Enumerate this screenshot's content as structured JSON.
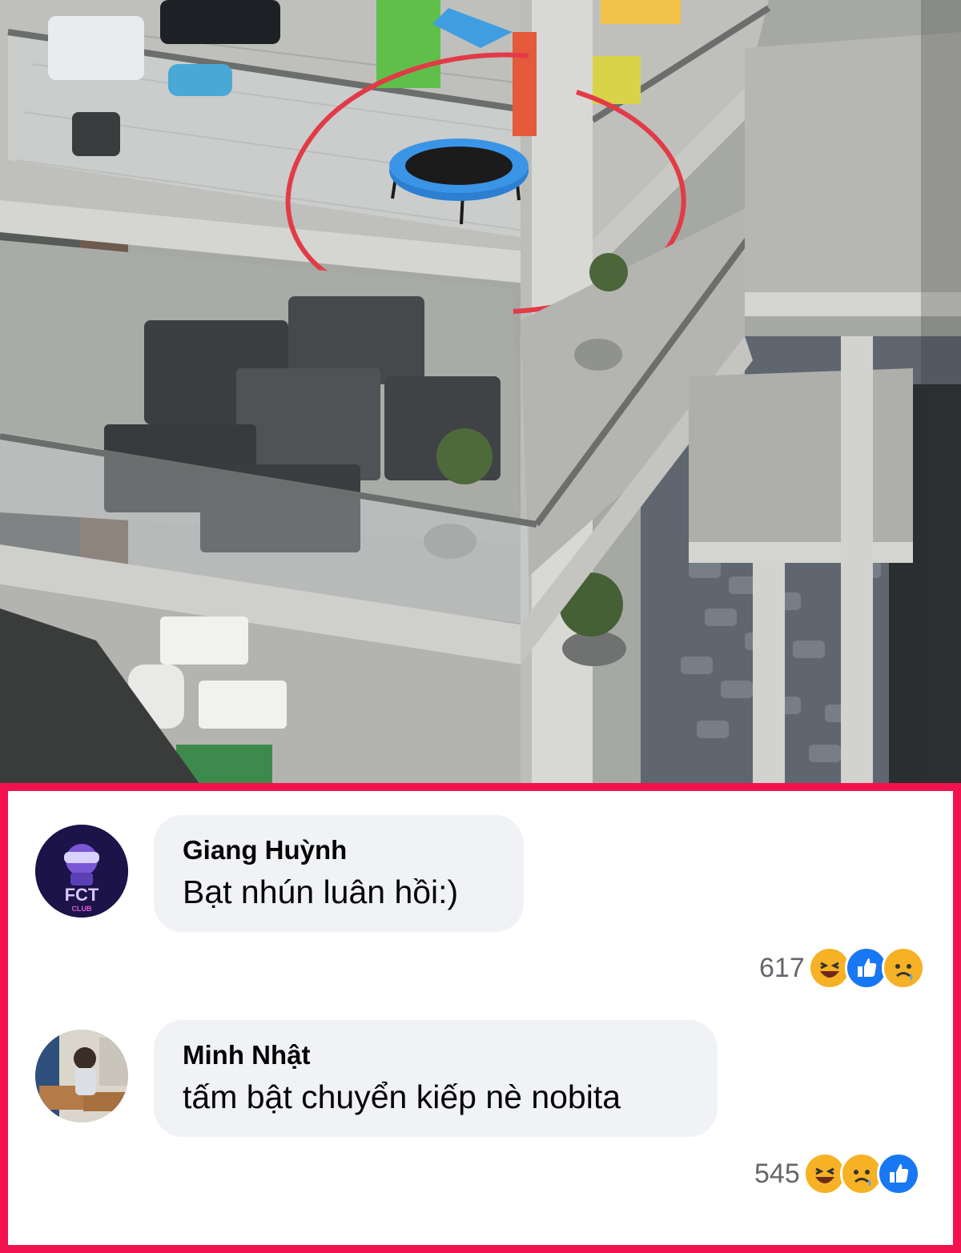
{
  "photo": {
    "description_icon": "balcony-photo",
    "highlight_color": "#e23b47"
  },
  "comments": [
    {
      "author": "Giang Huỳnh",
      "text": "Bạt nhún luân hồi:)",
      "reaction_count": "617",
      "reactions": [
        "haha-icon",
        "like-icon",
        "sad-icon"
      ],
      "avatar_text": "FCT",
      "avatar_subtext": "CLUB"
    },
    {
      "author": "Minh Nhật",
      "text": "tấm bật chuyển kiếp nè nobita",
      "reaction_count": "545",
      "reactions": [
        "haha-icon",
        "sad-icon",
        "like-icon"
      ]
    }
  ],
  "colors": {
    "frame_border": "#f2124f",
    "bubble_bg": "#f0f2f5",
    "like_blue": "#1877f2",
    "haha_yellow": "#f7b125",
    "count_gray": "#65676b"
  }
}
